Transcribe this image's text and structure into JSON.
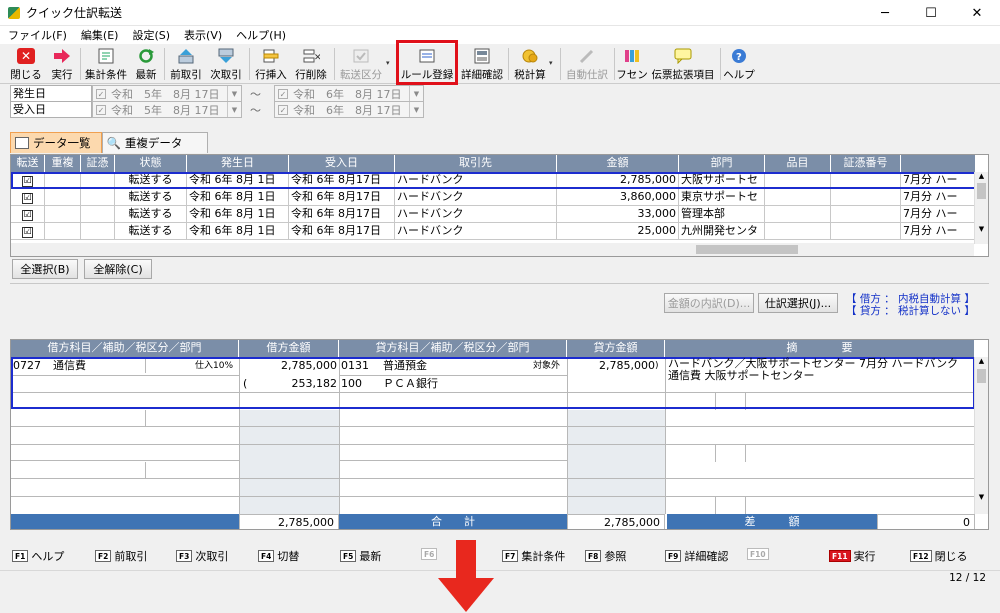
{
  "window": {
    "title": "クイック仕訳転送",
    "minimize": "─",
    "maximize": "☐",
    "close": "✕"
  },
  "menu": [
    "ファイル(F)",
    "編集(E)",
    "設定(S)",
    "表示(V)",
    "ヘルプ(H)"
  ],
  "toolbar": {
    "close": "閉じる",
    "execute": "実行",
    "aggregate": "集計条件",
    "refresh": "最新",
    "prev": "前取引",
    "next": "次取引",
    "insert_row": "行挿入",
    "delete_row": "行削除",
    "transfer_class": "転送区分",
    "rule_register": "ルール登録",
    "detail_confirm": "詳細確認",
    "tax_calc": "税計算",
    "auto_journal": "自動仕訳",
    "fusen": "フセン",
    "slip_ext": "伝票拡張項目",
    "help": "ヘルプ"
  },
  "accent": {
    "highlight": "#e0101a",
    "header": "#7b8ea8",
    "total_bar": "#3f74b4",
    "selection": "#1c2ccf",
    "tab_active": "#fcd9ae"
  },
  "filters": {
    "issue_date_label": "発生日",
    "receive_date_label": "受入日",
    "issue_from": "令和　5年　8月 17日",
    "issue_to": "令和　6年　8月 17日",
    "receive_from": "令和　5年　8月 17日",
    "receive_to": "令和　6年　8月 17日",
    "tilde": "～"
  },
  "tabs": {
    "data_list": "データ一覧",
    "duplicate": "重複データ"
  },
  "grid1": {
    "headers": [
      "転送",
      "重複",
      "証憑",
      "状態",
      "発生日",
      "受入日",
      "取引先",
      "金額",
      "部門",
      "品目",
      "証憑番号",
      ""
    ],
    "rows": [
      {
        "check": "☑",
        "state": "転送する",
        "issue": "令和 6年 8月 1日",
        "receive": "令和 6年 8月17日",
        "partner": "ハードバンク",
        "amount": "2,785,000",
        "dept": "大阪サポートセ",
        "memo": "7月分 ハー"
      },
      {
        "check": "☑",
        "state": "転送する",
        "issue": "令和 6年 8月 1日",
        "receive": "令和 6年 8月17日",
        "partner": "ハードバンク",
        "amount": "3,860,000",
        "dept": "東京サポートセ",
        "memo": "7月分 ハー"
      },
      {
        "check": "☑",
        "state": "転送する",
        "issue": "令和 6年 8月 1日",
        "receive": "令和 6年 8月17日",
        "partner": "ハードバンク",
        "amount": "33,000",
        "dept": "管理本部",
        "memo": "7月分 ハー"
      },
      {
        "check": "☑",
        "state": "転送する",
        "issue": "令和 6年 8月 1日",
        "receive": "令和 6年 8月17日",
        "partner": "ハードバンク",
        "amount": "25,000",
        "dept": "九州開発センタ",
        "memo": "7月分 ハー"
      }
    ]
  },
  "buttons": {
    "select_all": "全選択(B)",
    "deselect_all": "全解除(C)",
    "amount_detail": "金額の内訳(D)...",
    "journal_select": "仕訳選択(J)..."
  },
  "notes": {
    "line1": "【 借方 ： 内税自動計算 】",
    "line2": "【 貸方 ： 税計算しない 】"
  },
  "grid2": {
    "h_debit_acct": "借方科目／補助／税区分／部門",
    "h_debit_amt": "借方金額",
    "h_credit_acct": "貸方科目／補助／税区分／部門",
    "h_credit_amt": "貸方金額",
    "h_summary": "摘　　　　要",
    "debit_code": "0727",
    "debit_name": "通信費",
    "debit_tax": "仕入10%",
    "debit_amount": "2,785,000",
    "debit_tax_paren": "(",
    "debit_tax_amount": "253,182",
    "credit_code": "0131",
    "credit_name": "普通預金",
    "credit_tax": "対象外",
    "credit_amount": "2,785,000",
    "credit_paren": ")",
    "credit_sub_code": "100",
    "credit_sub_name": "ＰＣＡ銀行",
    "summary": "ハードバンク／大阪サポートセンター 7月分 ハードバンク 通信費 大阪サポートセンター",
    "total_debit": "2,785,000",
    "total_label": "合　　計",
    "total_credit": "2,785,000",
    "diff_label": "差　　　額",
    "diff_value": "0"
  },
  "fkeys": [
    {
      "key": "F1",
      "label": "ヘルプ"
    },
    {
      "key": "F2",
      "label": "前取引"
    },
    {
      "key": "F3",
      "label": "次取引"
    },
    {
      "key": "F4",
      "label": "切替"
    },
    {
      "key": "F5",
      "label": "最新"
    },
    {
      "key": "F6",
      "label": ""
    },
    {
      "key": "F7",
      "label": "集計条件"
    },
    {
      "key": "F8",
      "label": "参照"
    },
    {
      "key": "F9",
      "label": "詳細確認"
    },
    {
      "key": "F10",
      "label": ""
    },
    {
      "key": "F11",
      "label": "実行"
    },
    {
      "key": "F12",
      "label": "閉じる"
    }
  ],
  "page_info": "12 / 12"
}
